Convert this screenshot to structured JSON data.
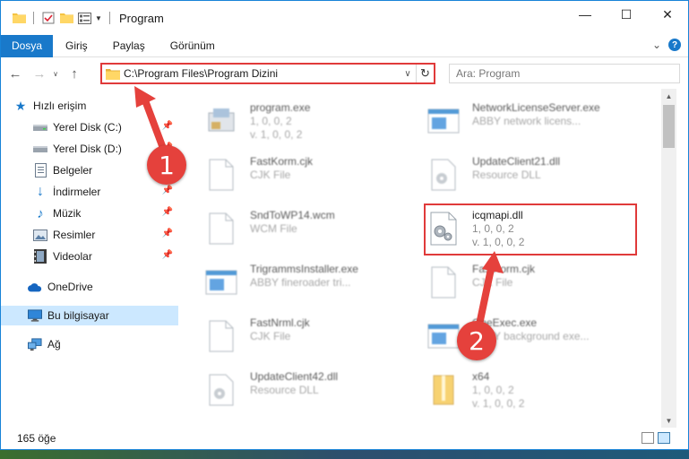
{
  "window": {
    "title": "Program",
    "controls": {
      "minimize": "—",
      "maximize": "☐",
      "close": "✕"
    }
  },
  "ribbon": {
    "tabs": [
      "Dosya",
      "Giriş",
      "Paylaş",
      "Görünüm"
    ],
    "expand": "⌄",
    "help": "?"
  },
  "address": {
    "path": "C:\\Program Files\\Program Dizini",
    "search_placeholder": "Ara: Program"
  },
  "nav": {
    "items": [
      {
        "label": "Hızlı erişim",
        "icon": "star-icon"
      },
      {
        "label": "Yerel Disk (C:)",
        "icon": "drive-icon",
        "pinned": true
      },
      {
        "label": "Yerel Disk (D:)",
        "icon": "drive-icon",
        "pinned": true
      },
      {
        "label": "Belgeler",
        "icon": "document-icon",
        "pinned": true
      },
      {
        "label": "İndirmeler",
        "icon": "download-icon",
        "pinned": true
      },
      {
        "label": "Müzik",
        "icon": "music-icon",
        "pinned": true
      },
      {
        "label": "Resimler",
        "icon": "pictures-icon",
        "pinned": true
      },
      {
        "label": "Videolar",
        "icon": "video-icon",
        "pinned": true
      },
      {
        "label": "OneDrive",
        "icon": "cloud-icon"
      },
      {
        "label": "Bu bilgisayar",
        "icon": "computer-icon",
        "selected": true
      },
      {
        "label": "Ağ",
        "icon": "network-icon"
      }
    ]
  },
  "files": [
    {
      "name": "program.exe",
      "line1": "1, 0, 0, 2",
      "line2": "v. 1, 0, 0, 2",
      "icon": "exe-icon"
    },
    {
      "name": "NetworkLicenseServer.exe",
      "line1": "ABBY network licens...",
      "line2": "",
      "icon": "app-icon"
    },
    {
      "name": "FastKorm.cjk",
      "line1": "CJK File",
      "line2": "",
      "icon": "file-icon"
    },
    {
      "name": "UpdateClient21.dll",
      "line1": "Resource DLL",
      "line2": "",
      "icon": "dll-icon"
    },
    {
      "name": "SndToWP14.wcm",
      "line1": "WCM File",
      "line2": "",
      "icon": "file-icon"
    },
    {
      "name": "icqmapi.dll",
      "line1": "1, 0, 0, 2",
      "line2": "v. 1, 0, 0, 2",
      "icon": "dll-icon"
    },
    {
      "name": "TrigrammsInstaller.exe",
      "line1": "ABBY fineroader tri...",
      "line2": "",
      "icon": "app-icon"
    },
    {
      "name": "FastKorm.cjk",
      "line1": "CJK File",
      "line2": "",
      "icon": "file-icon"
    },
    {
      "name": "FastNrml.cjk",
      "line1": "CJK File",
      "line2": "",
      "icon": "file-icon"
    },
    {
      "name": "OneExec.exe",
      "line1": "ABBY background exe...",
      "line2": "",
      "icon": "app-icon"
    },
    {
      "name": "UpdateClient42.dll",
      "line1": "Resource DLL",
      "line2": "",
      "icon": "dll-icon"
    },
    {
      "name": "x64",
      "line1": "1, 0, 0, 2",
      "line2": "v. 1, 0, 0, 2",
      "icon": "folder-zip-icon"
    }
  ],
  "status": {
    "count": "165 öğe"
  },
  "markers": [
    "1",
    "2"
  ],
  "colors": {
    "accent": "#1979ca",
    "highlight": "#e03a3a",
    "marker": "#e5413c"
  }
}
